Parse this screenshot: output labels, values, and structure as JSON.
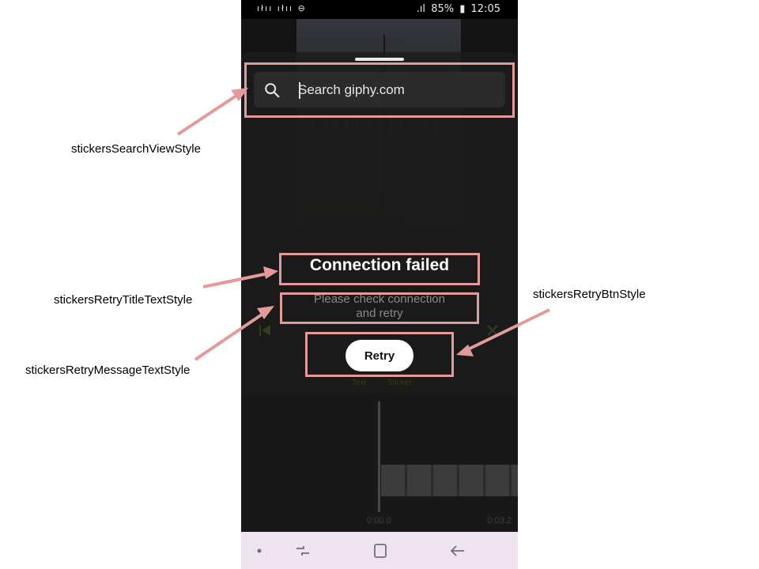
{
  "annotations": {
    "search_view": "stickersSearchViewStyle",
    "retry_title": "stickersRetryTitleTextStyle",
    "retry_message": "stickersRetryMessageTextStyle",
    "retry_button": "stickersRetryBtnStyle"
  },
  "status_bar": {
    "battery": "85%",
    "time": "12:05",
    "icons": [
      "notification-icon",
      "notification-icon",
      "do-not-disturb-icon",
      "signal-icon",
      "battery-icon"
    ]
  },
  "search": {
    "placeholder": "Search giphy.com",
    "icon": "search-icon"
  },
  "retry": {
    "title": "Connection failed",
    "message_line1": "Please check connection",
    "message_line2": "and retry",
    "button_label": "Retry"
  },
  "background_toolbar": {
    "text_label": "Text",
    "sticker_label": "Sticker"
  },
  "timeline": {
    "start_time": "0:00.0",
    "end_time": "0:03.2"
  },
  "nav_bar": {
    "icons": [
      "dot-icon",
      "recent-apps-icon",
      "home-icon",
      "back-icon"
    ]
  },
  "colors": {
    "annotation_highlight": "#e49a9a",
    "button_background": "#ffffff",
    "nav_bar_background": "#efe3ef"
  }
}
